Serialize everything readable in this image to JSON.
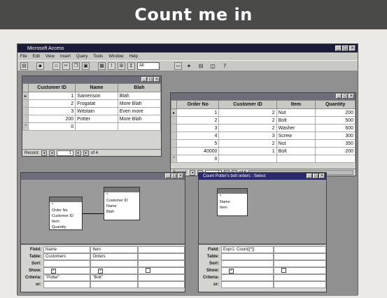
{
  "banner": {
    "title": "Count me in"
  },
  "app": {
    "title": "Microsoft Access",
    "menus": [
      "File",
      "Edit",
      "View",
      "Insert",
      "Query",
      "Tools",
      "Window",
      "Help"
    ],
    "toolbar_select": "All"
  },
  "customers_window": {
    "columns": [
      "Customer ID",
      "Name",
      "Blah"
    ],
    "rows": [
      {
        "id": "1",
        "name": "Samenson",
        "blah": "Blah"
      },
      {
        "id": "2",
        "name": "Frogatat",
        "blah": "More Blah"
      },
      {
        "id": "3",
        "name": "Witstain",
        "blah": "Even more"
      },
      {
        "id": "200",
        "name": "Potter",
        "blah": "More Blah"
      },
      {
        "id": "0",
        "name": "",
        "blah": ""
      }
    ],
    "record_label": "Record:",
    "record_value": "1",
    "record_of": "of 4"
  },
  "orders_window": {
    "columns": [
      "Order No",
      "Customer ID",
      "Item",
      "Quantity"
    ],
    "rows": [
      {
        "order": "1",
        "cust": "2",
        "item": "Nut",
        "qty": "200"
      },
      {
        "order": "2",
        "cust": "2",
        "item": "Bolt",
        "qty": "500"
      },
      {
        "order": "3",
        "cust": "2",
        "item": "Washer",
        "qty": "600"
      },
      {
        "order": "4",
        "cust": "3",
        "item": "Screw",
        "qty": "300"
      },
      {
        "order": "5",
        "cust": "2",
        "item": "Nut",
        "qty": "350"
      },
      {
        "order": "40000",
        "cust": "1",
        "item": "Bolt",
        "qty": "200"
      },
      {
        "order": "0",
        "cust": "",
        "item": "",
        "qty": ""
      }
    ],
    "record_label": "Record:",
    "record_value": "1",
    "record_of": "of 6"
  },
  "query1": {
    "title": "",
    "table1_fields": [
      "*",
      "Order No",
      "Customer ID",
      "Item",
      "Quantity"
    ],
    "table2_fields": [
      "*",
      "Customer ID",
      "Name",
      "Blah"
    ],
    "grid_labels": [
      "Field:",
      "Table:",
      "Sort:",
      "Show:",
      "Criteria:",
      "or:"
    ],
    "field1": "Name",
    "table1": "Customers",
    "criteria1": "\"Potter\"",
    "field2": "Item",
    "table2": "Orders",
    "criteria2": "\"Bolt\""
  },
  "query2": {
    "title": "Count Potter's bolt orders : Select",
    "table_fields": [
      "*",
      "Name",
      "Item"
    ],
    "grid_labels": [
      "Field:",
      "Table:",
      "Sort:",
      "Show:",
      "Criteria:",
      "or:"
    ],
    "field1": "Expr1: Count([*])"
  }
}
